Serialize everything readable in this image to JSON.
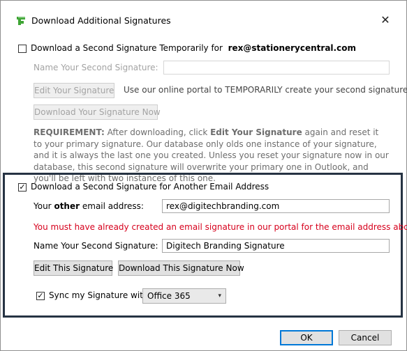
{
  "window": {
    "title": "Download Additional Signatures"
  },
  "section1": {
    "checkbox_label_prefix": "Download a Second Signature Temporarily for",
    "email": "rex@stationerycentral.com",
    "checked": false,
    "name_label": "Name Your Second Signature:",
    "name_value": "",
    "edit_button": "Edit Your Signature",
    "edit_hint": "Use our online portal to TEMPORARILY create your second signature",
    "download_button": "Download Your Signature Now",
    "requirement_title": "REQUIREMENT:",
    "requirement_part1": "After downloading, click",
    "requirement_bold": "Edit Your Signature",
    "requirement_part2": "again and reset it to your primary signature. Our database only olds one instance of your signature, and it is always the last one you created. Unless you reset your signature now in our database, this second signature will overwrite your primary one in Outlook, and you'll be left with two instances of this one."
  },
  "section2": {
    "checkbox_label": "Download a Second Signature for Another Email Address",
    "checked": true,
    "email_label_pre": "Your",
    "email_label_bold": "other",
    "email_label_post": "email address:",
    "email_value": "rex@digitechbranding.com",
    "warning": "You must have already created an email signature in our portal for the email address above.",
    "name_label": "Name Your Second Signature:",
    "name_value": "Digitech Branding Signature",
    "edit_button": "Edit This Signature",
    "download_button": "Download This Signature Now",
    "sync_label": "Sync my Signature with",
    "sync_checked": true,
    "sync_selected": "Office 365"
  },
  "footer": {
    "ok": "OK",
    "cancel": "Cancel"
  },
  "icons": {
    "logo": "app-logo-icon",
    "close": "close-icon",
    "check": "checkmark-icon",
    "dropdown": "chevron-down-icon"
  },
  "colors": {
    "panel_border": "#263343",
    "warning": "#d6001c",
    "ok_border": "#0078d7"
  }
}
